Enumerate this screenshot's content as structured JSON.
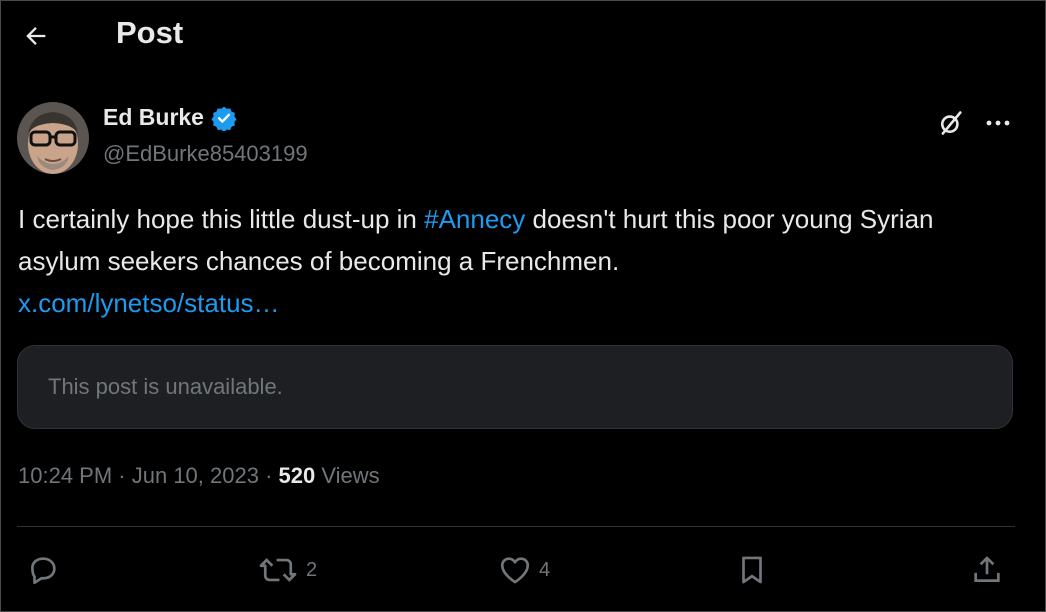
{
  "header": {
    "title": "Post"
  },
  "author": {
    "name": "Ed Burke",
    "handle": "@EdBurke85403199"
  },
  "post": {
    "text_before": "I certainly hope this little dust-up in ",
    "hashtag": "#Annecy",
    "text_after": " doesn't hurt this poor young Syrian asylum seekers chances of becoming a Frenchmen.",
    "link": "x.com/lynetso/status…"
  },
  "quoted": {
    "notice": "This post is unavailable."
  },
  "meta": {
    "time": "10:24 PM",
    "sep1": " · ",
    "date": "Jun 10, 2023",
    "sep2": " · ",
    "views_count": "520",
    "views_label": " Views"
  },
  "actions": {
    "replies": "",
    "reposts": "2",
    "likes": "4"
  },
  "colors": {
    "accent": "#1d9bf0",
    "muted": "#71767b",
    "text": "#e7e9ea",
    "background": "#000000"
  }
}
